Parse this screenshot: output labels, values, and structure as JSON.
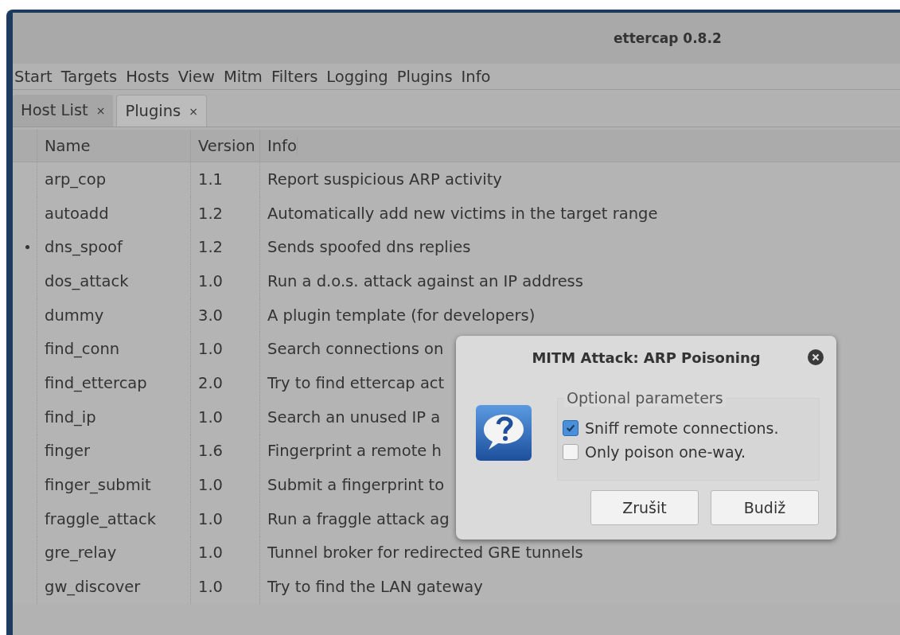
{
  "window": {
    "title": "ettercap 0.8.2"
  },
  "menu": [
    "Start",
    "Targets",
    "Hosts",
    "View",
    "Mitm",
    "Filters",
    "Logging",
    "Plugins",
    "Info"
  ],
  "tabs": [
    {
      "label": "Host List",
      "close": "×",
      "selected": false
    },
    {
      "label": "Plugins",
      "close": "×",
      "selected": true
    }
  ],
  "table": {
    "columns": [
      "Name",
      "Version",
      "Info"
    ],
    "rows": [
      {
        "active": false,
        "name": "arp_cop",
        "version": "1.1",
        "info": "Report suspicious ARP activity"
      },
      {
        "active": false,
        "name": "autoadd",
        "version": "1.2",
        "info": "Automatically add new victims in the target range"
      },
      {
        "active": true,
        "name": "dns_spoof",
        "version": "1.2",
        "info": "Sends spoofed dns replies"
      },
      {
        "active": false,
        "name": "dos_attack",
        "version": "1.0",
        "info": "Run a d.o.s. attack against an IP address"
      },
      {
        "active": false,
        "name": "dummy",
        "version": "3.0",
        "info": "A plugin template (for developers)"
      },
      {
        "active": false,
        "name": "find_conn",
        "version": "1.0",
        "info": "Search connections on"
      },
      {
        "active": false,
        "name": "find_ettercap",
        "version": "2.0",
        "info": "Try to find ettercap act"
      },
      {
        "active": false,
        "name": "find_ip",
        "version": "1.0",
        "info": "Search an unused IP a"
      },
      {
        "active": false,
        "name": "finger",
        "version": "1.6",
        "info": "Fingerprint a remote h"
      },
      {
        "active": false,
        "name": "finger_submit",
        "version": "1.0",
        "info": "Submit a fingerprint to"
      },
      {
        "active": false,
        "name": "fraggle_attack",
        "version": "1.0",
        "info": "Run a fraggle attack ag"
      },
      {
        "active": false,
        "name": "gre_relay",
        "version": "1.0",
        "info": "Tunnel broker for redirected GRE tunnels"
      },
      {
        "active": false,
        "name": "gw_discover",
        "version": "1.0",
        "info": "Try to find the LAN gateway"
      }
    ]
  },
  "dialog": {
    "title": "MITM Attack: ARP Poisoning",
    "group": "Optional parameters",
    "options": [
      {
        "label": "Sniff remote connections.",
        "checked": true
      },
      {
        "label": "Only poison one-way.",
        "checked": false
      }
    ],
    "buttons": [
      "Zrušit",
      "Budiž"
    ]
  }
}
